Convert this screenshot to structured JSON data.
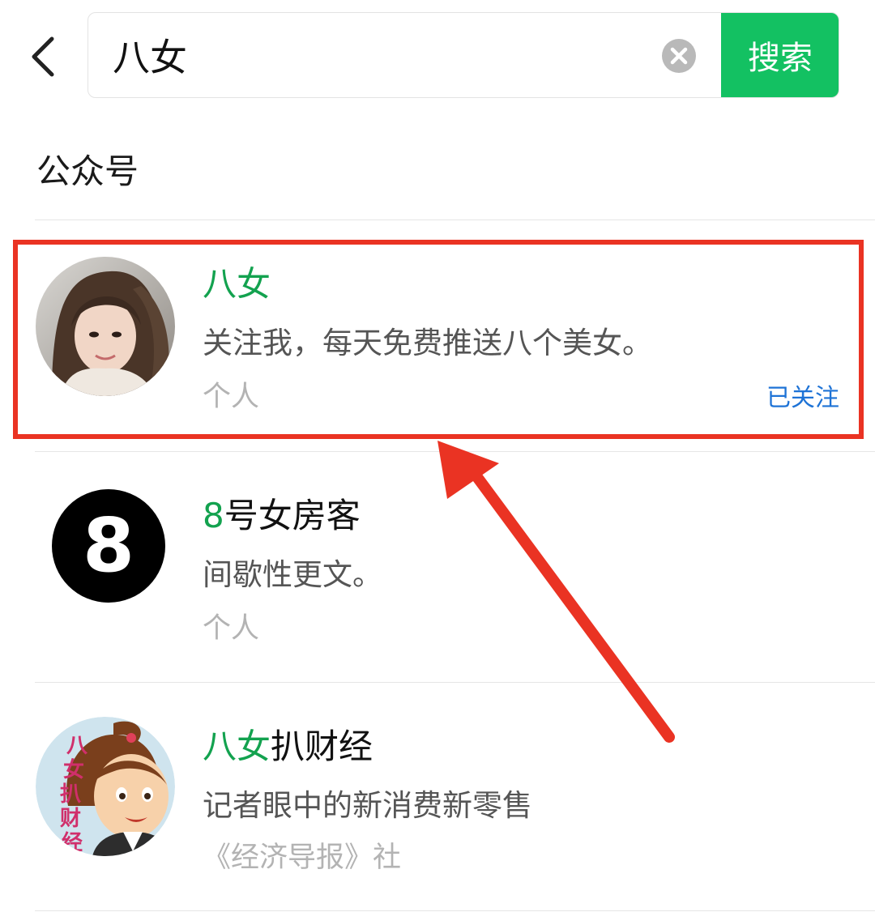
{
  "search": {
    "value": "八女",
    "button_label": "搜索"
  },
  "section": {
    "title": "公众号"
  },
  "results": [
    {
      "name_highlight": "八女",
      "name_rest": "",
      "description": "关注我，每天免费推送八个美女。",
      "type": "个人",
      "status": "已关注",
      "avatar": "girl-portrait"
    },
    {
      "name_highlight": "8",
      "name_rest": "号女房客",
      "description": "间歇性更文。",
      "type": "个人",
      "avatar_text": "8"
    },
    {
      "name_highlight": "八女",
      "name_rest": "扒财经",
      "description": "记者眼中的新消费新零售",
      "type": "《经济导报》社",
      "avatar": "cartoon-woman-logo",
      "avatar_logo_text": "八女扒财经"
    }
  ],
  "colors": {
    "accent_green": "#13c162",
    "highlight_green": "#13a24f",
    "followed_blue": "#1e73d6",
    "annotation_red": "#ea3323"
  },
  "icons": [
    "back-arrow-icon",
    "clear-icon"
  ]
}
